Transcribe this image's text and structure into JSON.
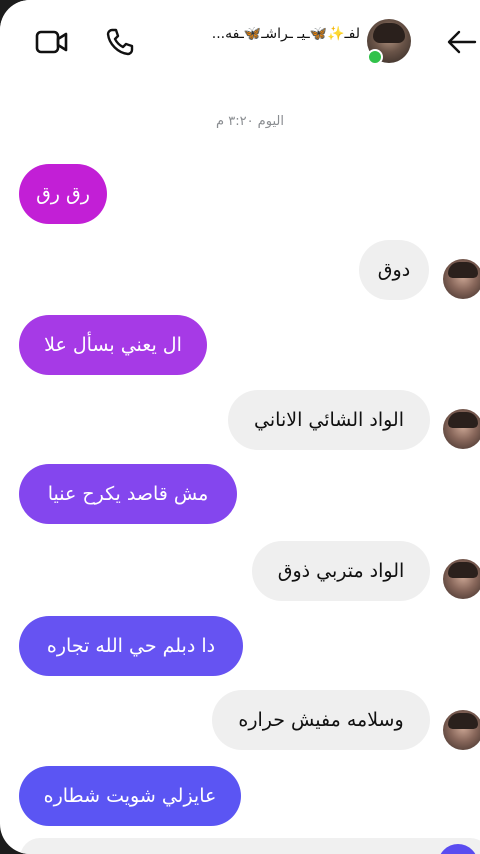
{
  "header": {
    "contact_name": "لفـ✨🦋ـيـ ـراشـ🦋ـفه...",
    "video_icon": "video-camera-icon",
    "call_icon": "phone-icon",
    "back_icon": "arrow-left-icon",
    "online_color": "#31c24a"
  },
  "timestamp": "اليوم ٣:٢٠ م",
  "messages": [
    {
      "side": "sent",
      "text": "رق رق",
      "color": "#c21fd6"
    },
    {
      "side": "received",
      "text": "دوق"
    },
    {
      "side": "sent",
      "text": "ال يعني بسأل علا",
      "color": "#a63ae6"
    },
    {
      "side": "received",
      "text": "الواد الشائي الاناني"
    },
    {
      "side": "sent",
      "text": "مش قاصد يكرح عنيا",
      "color": "#8446ee"
    },
    {
      "side": "received",
      "text": "الواد متربي ذوق"
    },
    {
      "side": "sent",
      "text": "دا دبلم حي الله تجاره",
      "color": "#6653f2"
    },
    {
      "side": "received",
      "text": "وسلامه مفيش حراره"
    },
    {
      "side": "sent",
      "text": "عايزلي شويت شطاره",
      "color": "#5b55f3"
    }
  ]
}
